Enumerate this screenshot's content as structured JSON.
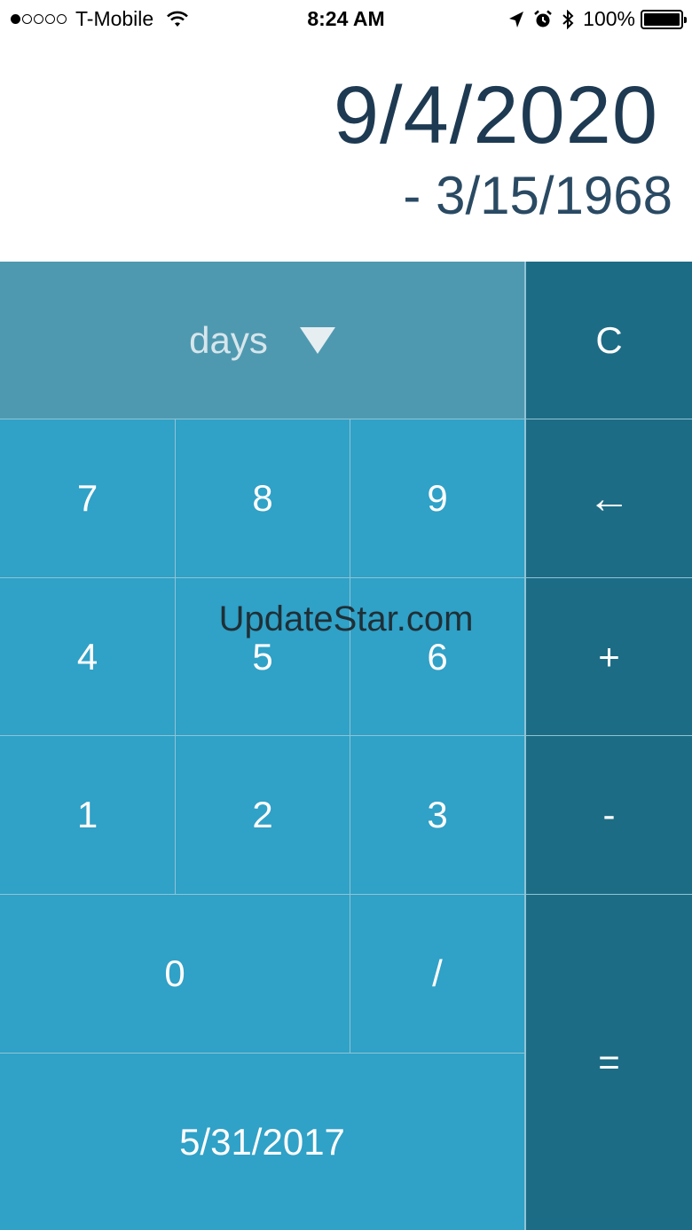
{
  "status_bar": {
    "carrier": "T-Mobile",
    "time": "8:24 AM",
    "battery": "100%"
  },
  "display": {
    "primary": "9/4/2020",
    "secondary": "- 3/15/1968"
  },
  "unit_selector": {
    "label": "days"
  },
  "keys": {
    "clear": "C",
    "backspace": "←",
    "plus": "+",
    "minus": "-",
    "equals": "=",
    "k7": "7",
    "k8": "8",
    "k9": "9",
    "k4": "4",
    "k5": "5",
    "k6": "6",
    "k1": "1",
    "k2": "2",
    "k3": "3",
    "k0": "0",
    "slash": "/",
    "today": "5/31/2017"
  },
  "watermark": "UpdateStar.com",
  "colors": {
    "number_key": "#30a1c7",
    "operator_key": "#1d6c85",
    "unit_selector": "#4f99b0",
    "display_text": "#1e3a52"
  }
}
